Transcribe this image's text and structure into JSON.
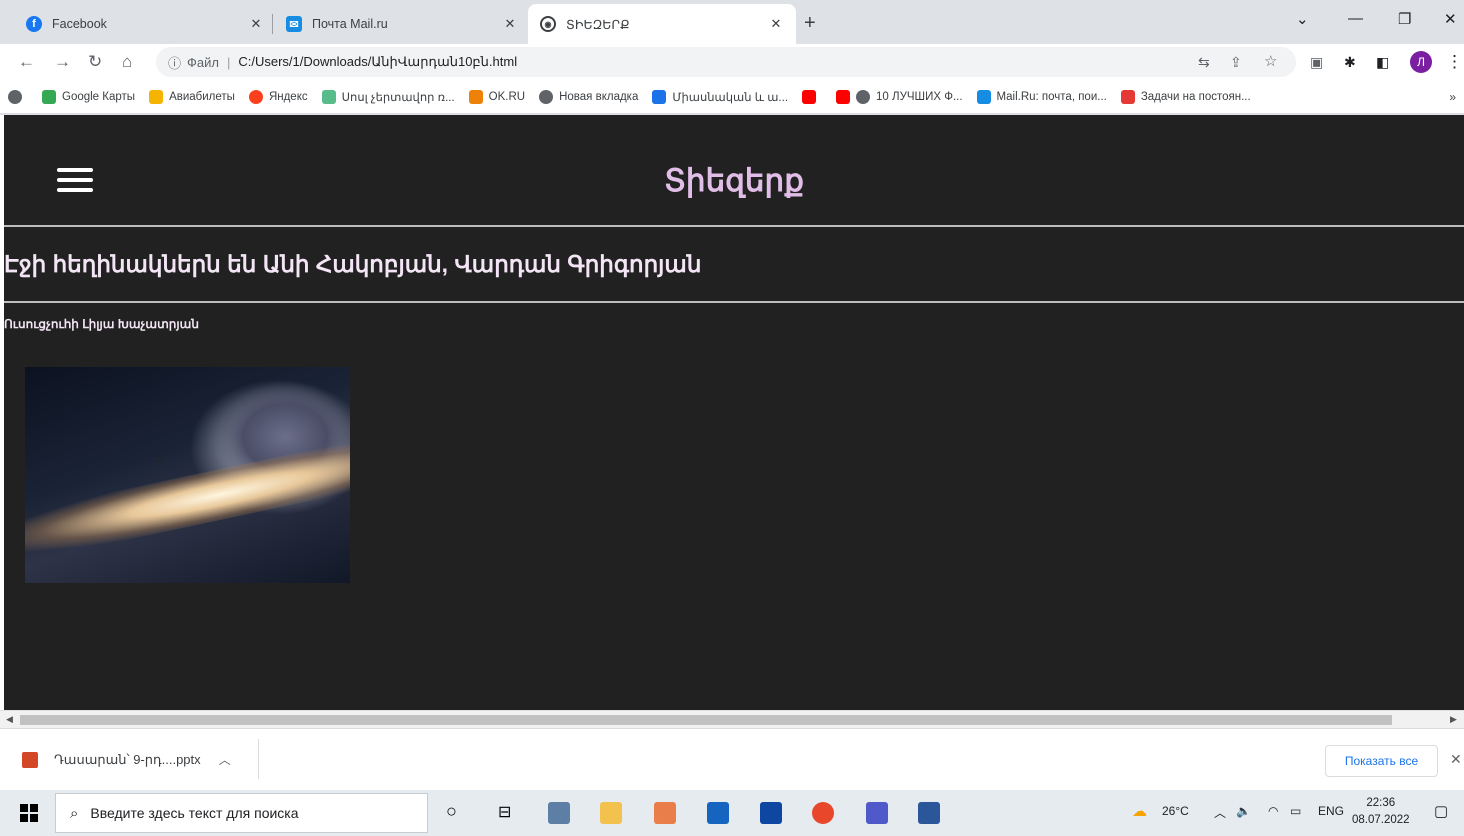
{
  "tabs": [
    {
      "label": "Facebook",
      "color": "#1877f2",
      "glyph": "f"
    },
    {
      "label": "Почта Mail.ru",
      "color": "#168de2",
      "glyph": "✉"
    },
    {
      "label": "ՏԻԵԶԵՐՔ",
      "color": "#5f6368",
      "glyph": "◉"
    }
  ],
  "toolbar": {
    "address_label": "Файл",
    "url": "C:/Users/1/Downloads/ԱնիՎարդան10բն.html",
    "avatar_letter": "Л"
  },
  "bookmarks": [
    {
      "label": "Google Карты",
      "color": "#34a853"
    },
    {
      "label": "Авиабилеты",
      "color": "#f4b400"
    },
    {
      "label": "Яндекс",
      "color": "#fc3f1d"
    },
    {
      "label": "Սոսլ չերտավոր ռ...",
      "color": "#57bb8a"
    },
    {
      "label": "OK.RU",
      "color": "#ee8208"
    },
    {
      "label": "Новая вкладка",
      "color": "#5f6368"
    },
    {
      "label": "Միասնական և ա...",
      "color": "#1a73e8"
    },
    {
      "label": "",
      "color": "#ff0000"
    },
    {
      "label": "10 ЛУЧШИХ Ф...",
      "color": "#ff0000"
    },
    {
      "label": "Mail.Ru: почта, пои...",
      "color": "#168de2"
    },
    {
      "label": "Задачи на постоян...",
      "color": "#e53935"
    }
  ],
  "page": {
    "site_title": "Տիեզերք",
    "authors": "Էջի հեղինակներն են Անի Հակոբյան, Վարդան Գրիգորյան",
    "teacher": "Ուսուցչուհի Լիլյա Խաչատրյան"
  },
  "download": {
    "file_name": "Դասարան՝ 9-րդ....pptx",
    "show_all": "Показать все"
  },
  "taskbar": {
    "search_placeholder": "Введите здесь текст для поиска",
    "weather": "26°C",
    "lang": "ENG",
    "time": "22:36",
    "date": "08.07.2022"
  }
}
